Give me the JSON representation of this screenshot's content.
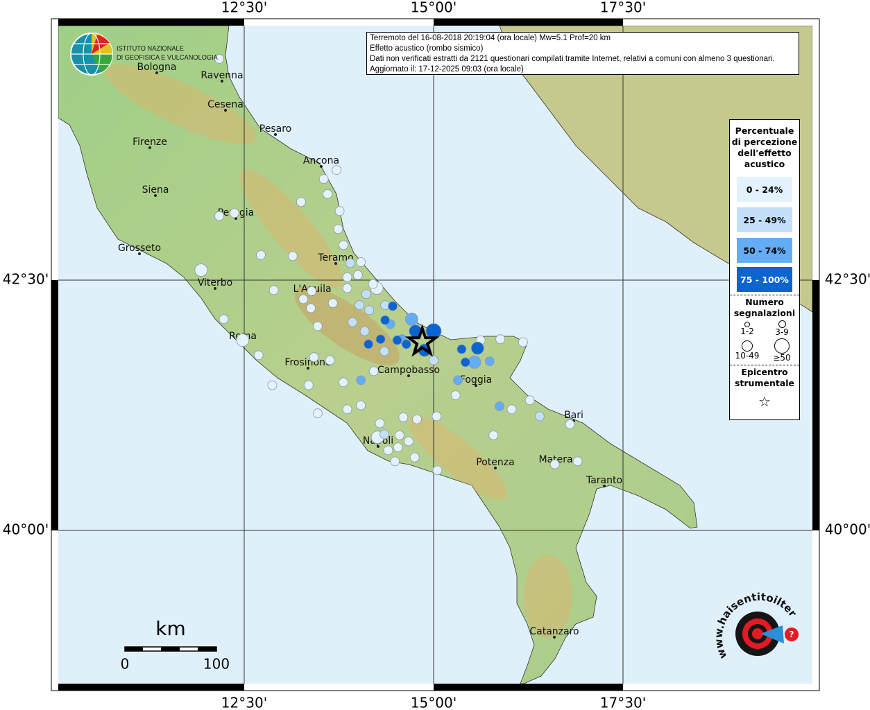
{
  "header": {
    "line1": "Terremoto del 16-08-2018 20:19:04 (ora locale) Mw=5.1 Prof=20 km",
    "line2": "Effetto acustico (rombo sismico)",
    "line3": "Dati non verificati estratti da 2121 questionari compilati tramite Internet, relativi a comuni con almeno 3 questionari.",
    "line4": "Aggiornato il: 17-12-2025 09:03 (ora locale)"
  },
  "logo_ingv": {
    "line1": "ISTITUTO NAZIONALE",
    "line2": "DI GEOFISICA E VULCANOLOGIA"
  },
  "logo_hsit": {
    "text": "www.haisentitoilterremoto.it"
  },
  "axes": {
    "lon_labels": [
      "12°30'",
      "15°00'",
      "17°30'"
    ],
    "lat_labels": [
      "42°30'",
      "40°00'"
    ],
    "lon_values": [
      12.5,
      15.0,
      17.5
    ],
    "lat_values": [
      42.5,
      40.0
    ]
  },
  "scale_bar": {
    "unit": "km",
    "start": "0",
    "end": "100"
  },
  "legend": {
    "title": "Percentuale di percezione dell'effetto acustico",
    "classes": [
      {
        "label": "0 - 24%",
        "color": "#e3f2fe"
      },
      {
        "label": "25 - 49%",
        "color": "#c3e0fb"
      },
      {
        "label": "50 - 74%",
        "color": "#64adf4"
      },
      {
        "label": "75 - 100%",
        "color": "#0a65d0"
      }
    ],
    "count_title": "Numero segnalazioni",
    "counts": [
      "1-2",
      "3-9",
      "10-49",
      "≥50"
    ],
    "epicenter_title": "Epicentro strumentale",
    "epicenter_icon": "star-outline-icon"
  },
  "epicenter": {
    "lon": 14.85,
    "lat": 41.88
  },
  "cities": [
    "Bologna",
    "Ravenna",
    "Cesena",
    "Pesaro",
    "Firenze",
    "Ancona",
    "Siena",
    "Perugia",
    "Grosseto",
    "Teramo",
    "Viterbo",
    "L'Aquila",
    "Roma",
    "Frosinone",
    "Campobasso",
    "Foggia",
    "Bari",
    "Napoli",
    "Potenza",
    "Matera",
    "Taranto",
    "Catanzaro"
  ],
  "observations_note": "each: [lon, lat, percent class 0-3, count class 0-3]",
  "observations": [
    [
      15.0,
      41.99,
      3,
      3
    ],
    [
      14.71,
      42.11,
      2,
      2
    ],
    [
      14.76,
      41.99,
      3,
      2
    ],
    [
      14.88,
      41.8,
      3,
      2
    ],
    [
      14.64,
      41.86,
      3,
      1
    ],
    [
      14.52,
      41.9,
      3,
      1
    ],
    [
      14.36,
      42.1,
      3,
      1
    ],
    [
      14.46,
      42.24,
      3,
      1
    ],
    [
      14.3,
      41.91,
      3,
      1
    ],
    [
      14.14,
      41.86,
      3,
      1
    ],
    [
      14.43,
      42.06,
      2,
      1
    ],
    [
      14.58,
      41.91,
      2,
      1
    ],
    [
      15.37,
      41.81,
      3,
      1
    ],
    [
      15.58,
      41.82,
      3,
      2
    ],
    [
      15.42,
      41.68,
      3,
      1
    ],
    [
      15.74,
      41.69,
      2,
      1
    ],
    [
      15.54,
      41.68,
      2,
      2
    ],
    [
      15.32,
      41.5,
      2,
      1
    ],
    [
      15.0,
      41.7,
      1,
      1
    ],
    [
      14.36,
      42.25,
      1,
      1
    ],
    [
      14.25,
      42.42,
      0,
      2
    ],
    [
      14.11,
      42.36,
      1,
      1
    ],
    [
      14.02,
      42.25,
      1,
      1
    ],
    [
      13.93,
      42.08,
      1,
      1
    ],
    [
      14.04,
      41.5,
      2,
      1
    ],
    [
      14.09,
      41.99,
      1,
      1
    ],
    [
      14.35,
      41.79,
      1,
      1
    ],
    [
      13.67,
      42.27,
      0,
      1
    ],
    [
      13.86,
      42.42,
      0,
      1
    ],
    [
      13.86,
      42.53,
      0,
      1
    ],
    [
      13.9,
      42.67,
      1,
      1
    ],
    [
      14.04,
      42.68,
      0,
      1
    ],
    [
      13.81,
      42.85,
      0,
      1
    ],
    [
      13.74,
      43.01,
      0,
      1
    ],
    [
      13.76,
      43.19,
      0,
      1
    ],
    [
      13.6,
      43.36,
      0,
      1
    ],
    [
      13.55,
      43.51,
      0,
      1
    ],
    [
      13.25,
      43.28,
      0,
      1
    ],
    [
      13.14,
      42.74,
      0,
      1
    ],
    [
      12.89,
      42.4,
      0,
      1
    ],
    [
      13.39,
      42.39,
      0,
      1
    ],
    [
      13.38,
      42.22,
      0,
      1
    ],
    [
      13.47,
      42.04,
      0,
      1
    ],
    [
      13.42,
      41.73,
      0,
      1
    ],
    [
      13.63,
      41.7,
      0,
      1
    ],
    [
      13.35,
      41.45,
      0,
      1
    ],
    [
      13.81,
      41.48,
      0,
      1
    ],
    [
      14.21,
      41.59,
      0,
      1
    ],
    [
      14.04,
      41.25,
      0,
      1
    ],
    [
      14.29,
      41.07,
      0,
      1
    ],
    [
      14.26,
      40.93,
      0,
      2
    ],
    [
      14.53,
      40.83,
      0,
      1
    ],
    [
      14.49,
      40.69,
      0,
      1
    ],
    [
      14.75,
      40.73,
      0,
      1
    ],
    [
      14.78,
      41.11,
      0,
      1
    ],
    [
      15.04,
      41.14,
      0,
      1
    ],
    [
      15.29,
      41.35,
      0,
      1
    ],
    [
      15.79,
      40.95,
      0,
      1
    ],
    [
      16.03,
      41.21,
      0,
      1
    ],
    [
      16.27,
      41.3,
      0,
      1
    ],
    [
      16.4,
      41.14,
      1,
      1
    ],
    [
      16.8,
      41.06,
      0,
      1
    ],
    [
      15.87,
      41.24,
      2,
      1
    ],
    [
      16.18,
      41.88,
      0,
      1
    ],
    [
      15.88,
      41.91,
      0,
      1
    ],
    [
      15.62,
      41.9,
      0,
      1
    ],
    [
      16.9,
      40.69,
      0,
      1
    ],
    [
      16.6,
      40.66,
      0,
      1
    ],
    [
      15.05,
      40.6,
      0,
      1
    ],
    [
      12.48,
      41.9,
      0,
      2
    ],
    [
      12.23,
      42.11,
      0,
      1
    ],
    [
      12.69,
      41.75,
      0,
      1
    ],
    [
      12.87,
      41.45,
      0,
      1
    ],
    [
      11.93,
      42.6,
      0,
      2
    ],
    [
      12.17,
      43.14,
      0,
      1
    ],
    [
      12.37,
      43.17,
      0,
      1
    ],
    [
      13.28,
      42.31,
      0,
      1
    ],
    [
      12.72,
      42.75,
      0,
      1
    ],
    [
      13.72,
      43.6,
      0,
      1
    ],
    [
      12.17,
      44.71,
      0,
      1
    ],
    [
      13.47,
      41.17,
      0,
      1
    ],
    [
      14.6,
      41.13,
      0,
      1
    ],
    [
      14.35,
      40.96,
      1,
      1
    ],
    [
      14.67,
      40.89,
      0,
      1
    ],
    [
      13.86,
      41.21,
      0,
      1
    ],
    [
      14.2,
      42.46,
      0,
      1
    ],
    [
      14.0,
      42.55,
      0,
      1
    ],
    [
      14.15,
      42.2,
      1,
      1
    ],
    [
      14.4,
      40.8,
      0,
      1
    ],
    [
      14.55,
      40.95,
      0,
      1
    ]
  ]
}
